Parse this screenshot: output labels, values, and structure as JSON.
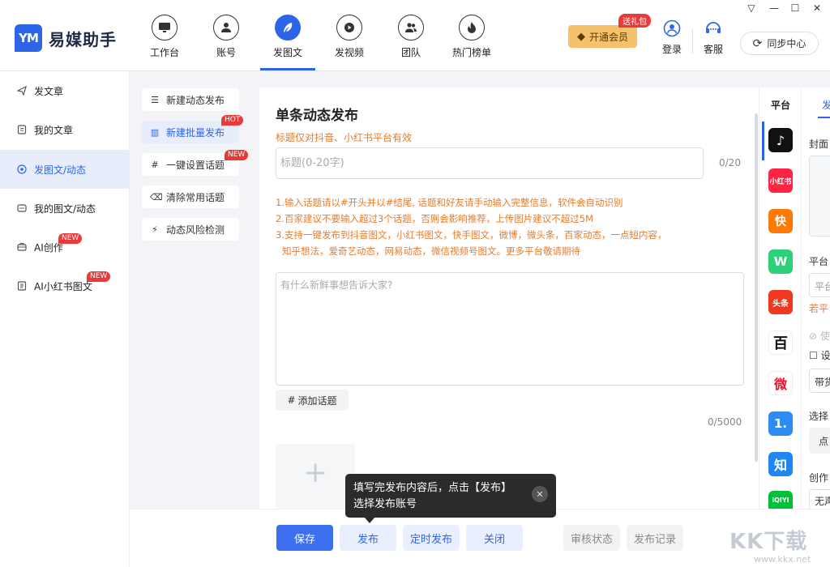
{
  "app": {
    "name": "易媒助手",
    "logo_mark": "YM"
  },
  "topnav": [
    {
      "label": "工作台",
      "icon": "monitor-icon"
    },
    {
      "label": "账号",
      "icon": "user-icon"
    },
    {
      "label": "发图文",
      "icon": "feather-icon"
    },
    {
      "label": "发视频",
      "icon": "video-icon"
    },
    {
      "label": "团队",
      "icon": "team-icon"
    },
    {
      "label": "热门榜单",
      "icon": "fire-icon"
    }
  ],
  "topnav_active": "发图文",
  "vip": {
    "label": "开通会员",
    "gift_badge": "送礼包"
  },
  "tools": {
    "login": "登录",
    "service": "客服",
    "sync": "同步中心"
  },
  "sidebar": [
    {
      "label": "发文章",
      "icon": "send-icon"
    },
    {
      "label": "我的文章",
      "icon": "doc-icon"
    },
    {
      "label": "发图文/动态",
      "icon": "target-icon"
    },
    {
      "label": "我的图文/动态",
      "icon": "chat-icon"
    },
    {
      "label": "AI创作",
      "icon": "ai-icon",
      "badge": "NEW"
    },
    {
      "label": "AI小红书图文",
      "icon": "note-icon",
      "badge": "NEW"
    }
  ],
  "subnav": [
    {
      "label": "新建动态发布",
      "icon": "add-list-icon"
    },
    {
      "label": "新建批量发布",
      "icon": "batch-icon",
      "badge": "HOT"
    },
    {
      "label": "一键设置话题",
      "icon": "hash-icon",
      "badge": "NEW"
    },
    {
      "label": "清除常用话题",
      "icon": "clear-icon"
    },
    {
      "label": "动态风险检测",
      "icon": "shield-icon"
    }
  ],
  "main": {
    "title": "单条动态发布",
    "subtitle": "标题仅对抖音、小红书平台有效",
    "title_placeholder": "标题(0-20字)",
    "title_count": "0/20",
    "tips": [
      "1.输入话题请以#开头并以#结尾, 话题和好友请手动输入完整信息，软件会自动识别",
      "2.百家建议不要输入超过3个话题，否则会影响推荐，上传图片建议不超过5M",
      "3.支持一键发布到抖音图文，小红书图文，快手图文，微博，微头条，百家动态，一点短内容，",
      "知乎想法，爱奇艺动态，网易动态，微信视频号图文。更多平台敬请期待"
    ],
    "content_placeholder": "有什么新鲜事想告诉大家?",
    "add_topic": "添加话题",
    "content_count": "0/5000"
  },
  "tooltip": {
    "line1": "填写完发布内容后，点击【发布】",
    "line2": "选择发布账号"
  },
  "bottom": {
    "save": "保存",
    "publish": "发布",
    "schedule": "定时发布",
    "close": "关闭",
    "review": "审核状态",
    "records": "发布记录"
  },
  "platforms": {
    "header": "平台",
    "items": [
      {
        "name": "douyin",
        "label": "♪",
        "color": "#111111"
      },
      {
        "name": "xiaohongshu",
        "label": "小红书",
        "color": "#ff2442"
      },
      {
        "name": "kuaishou",
        "label": "快",
        "color": "#ff7a00"
      },
      {
        "name": "weishi",
        "label": "W",
        "color": "#2fd07a"
      },
      {
        "name": "toutiao",
        "label": "头条",
        "color": "#f0371f"
      },
      {
        "name": "baijia",
        "label": "百",
        "color": "#ffffff"
      },
      {
        "name": "weibo",
        "label": "微",
        "color": "#ffffff"
      },
      {
        "name": "yidian",
        "label": "1.",
        "color": "#2e8cf0"
      },
      {
        "name": "zhihu",
        "label": "知",
        "color": "#1e88f0"
      },
      {
        "name": "iqiyi",
        "label": "iQIYI",
        "color": "#00c03a"
      }
    ]
  },
  "right_panel": {
    "tab": "发",
    "cover": "封面",
    "platform": "平台",
    "hint": "若平",
    "opt1": "使",
    "opt2": "设",
    "select": "带货",
    "choose": "选择",
    "btn": "点",
    "create": "创作",
    "none": "无声"
  },
  "watermark": {
    "main": "KK下载",
    "url": "www.kkx.net"
  }
}
